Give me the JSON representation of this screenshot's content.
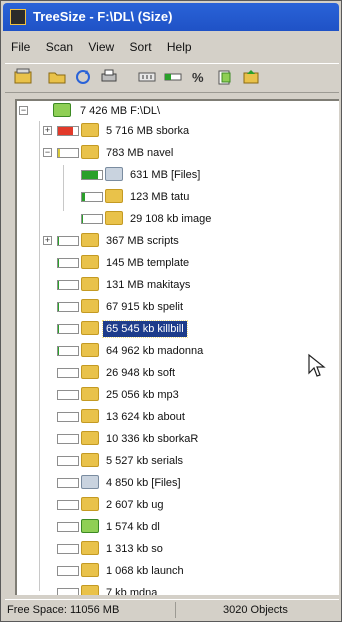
{
  "window": {
    "title": "TreeSize - F:\\DL\\ (Size)"
  },
  "menu": {
    "items": [
      "File",
      "Scan",
      "View",
      "Sort",
      "Help"
    ]
  },
  "toolbar": {
    "icons": [
      "folder-up-icon",
      "open-folder-icon",
      "refresh-icon",
      "print-icon",
      "bytes-icon",
      "size-bar-icon",
      "percent-icon",
      "files-icon",
      "export-icon"
    ]
  },
  "tree": {
    "root": {
      "label": "7 426 MB  F:\\DL\\",
      "icon": "drive-folder-icon"
    },
    "rows": [
      {
        "label": "5 716 MB  sborka",
        "fill": 0.77,
        "fill_color": "#e23a2a",
        "expanded": false,
        "has_expander": true,
        "kind": "folder"
      },
      {
        "label": "783 MB  navel",
        "fill": 0.11,
        "fill_color": "#d8c83a",
        "expanded": true,
        "has_expander": true,
        "kind": "folder"
      },
      {
        "label": "631 MB  [Files]",
        "fill": 0.81,
        "fill_color": "#2aa02a",
        "expanded": false,
        "has_expander": false,
        "kind": "files"
      },
      {
        "label": "123 MB  tatu",
        "fill": 0.16,
        "fill_color": "#2aa02a",
        "expanded": false,
        "has_expander": false,
        "kind": "folder"
      },
      {
        "label": "29 108 kb  image",
        "fill": 0.04,
        "fill_color": "#2aa02a",
        "expanded": false,
        "has_expander": false,
        "kind": "folder"
      },
      {
        "label": "367 MB  scripts",
        "fill": 0.05,
        "fill_color": "#2aa02a",
        "expanded": false,
        "has_expander": true,
        "kind": "folder"
      },
      {
        "label": "145 MB  template",
        "fill": 0.02,
        "fill_color": "#2aa02a",
        "expanded": false,
        "has_expander": false,
        "kind": "folder"
      },
      {
        "label": "131 MB  makitays",
        "fill": 0.02,
        "fill_color": "#2aa02a",
        "expanded": false,
        "has_expander": false,
        "kind": "folder"
      },
      {
        "label": "67 915 kb  spelit",
        "fill": 0.01,
        "fill_color": "#2aa02a",
        "expanded": false,
        "has_expander": false,
        "kind": "folder"
      },
      {
        "label": "65 545 kb  killbill",
        "fill": 0.01,
        "fill_color": "#2aa02a",
        "expanded": false,
        "has_expander": false,
        "kind": "folder",
        "selected": true
      },
      {
        "label": "64 962 kb  madonna",
        "fill": 0.01,
        "fill_color": "#2aa02a",
        "expanded": false,
        "has_expander": false,
        "kind": "folder"
      },
      {
        "label": "26 948 kb  soft",
        "fill": 0.0,
        "fill_color": "#2aa02a",
        "expanded": false,
        "has_expander": false,
        "kind": "folder"
      },
      {
        "label": "25 056 kb  mp3",
        "fill": 0.0,
        "fill_color": "#2aa02a",
        "expanded": false,
        "has_expander": false,
        "kind": "folder"
      },
      {
        "label": "13 624 kb  about",
        "fill": 0.0,
        "fill_color": "#2aa02a",
        "expanded": false,
        "has_expander": false,
        "kind": "folder"
      },
      {
        "label": "10 336 kb  sborkaR",
        "fill": 0.0,
        "fill_color": "#2aa02a",
        "expanded": false,
        "has_expander": false,
        "kind": "folder"
      },
      {
        "label": "5 527 kb  serials",
        "fill": 0.0,
        "fill_color": "#2aa02a",
        "expanded": false,
        "has_expander": false,
        "kind": "folder"
      },
      {
        "label": "4 850 kb  [Files]",
        "fill": 0.0,
        "fill_color": "#2aa02a",
        "expanded": false,
        "has_expander": false,
        "kind": "files"
      },
      {
        "label": "2 607 kb  ug",
        "fill": 0.0,
        "fill_color": "#2aa02a",
        "expanded": false,
        "has_expander": false,
        "kind": "folder"
      },
      {
        "label": "1 574 kb  dl",
        "fill": 0.0,
        "fill_color": "#2aa02a",
        "expanded": false,
        "has_expander": false,
        "kind": "special"
      },
      {
        "label": "1 313 kb  so",
        "fill": 0.0,
        "fill_color": "#2aa02a",
        "expanded": false,
        "has_expander": false,
        "kind": "folder"
      },
      {
        "label": "1 068 kb  launch",
        "fill": 0.0,
        "fill_color": "#2aa02a",
        "expanded": false,
        "has_expander": false,
        "kind": "folder"
      },
      {
        "label": "7 kb  mdna",
        "fill": 0.0,
        "fill_color": "#2aa02a",
        "expanded": false,
        "has_expander": false,
        "kind": "folder"
      }
    ]
  },
  "status": {
    "free_space": "Free Space: 11056 MB",
    "objects": "3020 Objects"
  }
}
